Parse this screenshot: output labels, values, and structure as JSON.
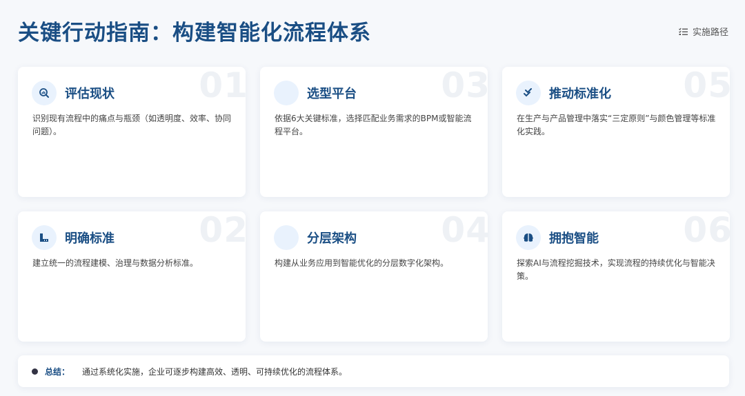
{
  "header": {
    "title": "关键行动指南：构建智能化流程体系",
    "path_link_label": "实施路径",
    "path_link_icon": "list-check-icon"
  },
  "cards": [
    {
      "number": "01",
      "title": "评估现状",
      "description": "识别现有流程中的痛点与瓶颈（如透明度、效率、协同问题）。",
      "icon": "search-chart-icon"
    },
    {
      "number": "03",
      "title": "选型平台",
      "description": "依据6大关键标准，选择匹配业务需求的BPM或智能流程平台。",
      "icon": ""
    },
    {
      "number": "05",
      "title": "推动标准化",
      "description": "在生产与产品管理中落实“三定原则”与颜色管理等标准化实践。",
      "icon": "double-check-icon"
    },
    {
      "number": "02",
      "title": "明确标准",
      "description": "建立统一的流程建模、治理与数据分析标准。",
      "icon": "ruler-icon"
    },
    {
      "number": "04",
      "title": "分层架构",
      "description": "构建从业务应用到智能优化的分层数字化架构。",
      "icon": ""
    },
    {
      "number": "06",
      "title": "拥抱智能",
      "description": "探索AI与流程挖掘技术，实现流程的持续优化与智能决策。",
      "icon": "brain-icon"
    }
  ],
  "summary": {
    "label": "总结：",
    "text": "通过系统化实施，企业可逐步构建高效、透明、可持续优化的流程体系。"
  },
  "colors": {
    "accent": "#1a4e84",
    "icon_bg": "#e9f2fd",
    "background": "#f6f8fb"
  }
}
